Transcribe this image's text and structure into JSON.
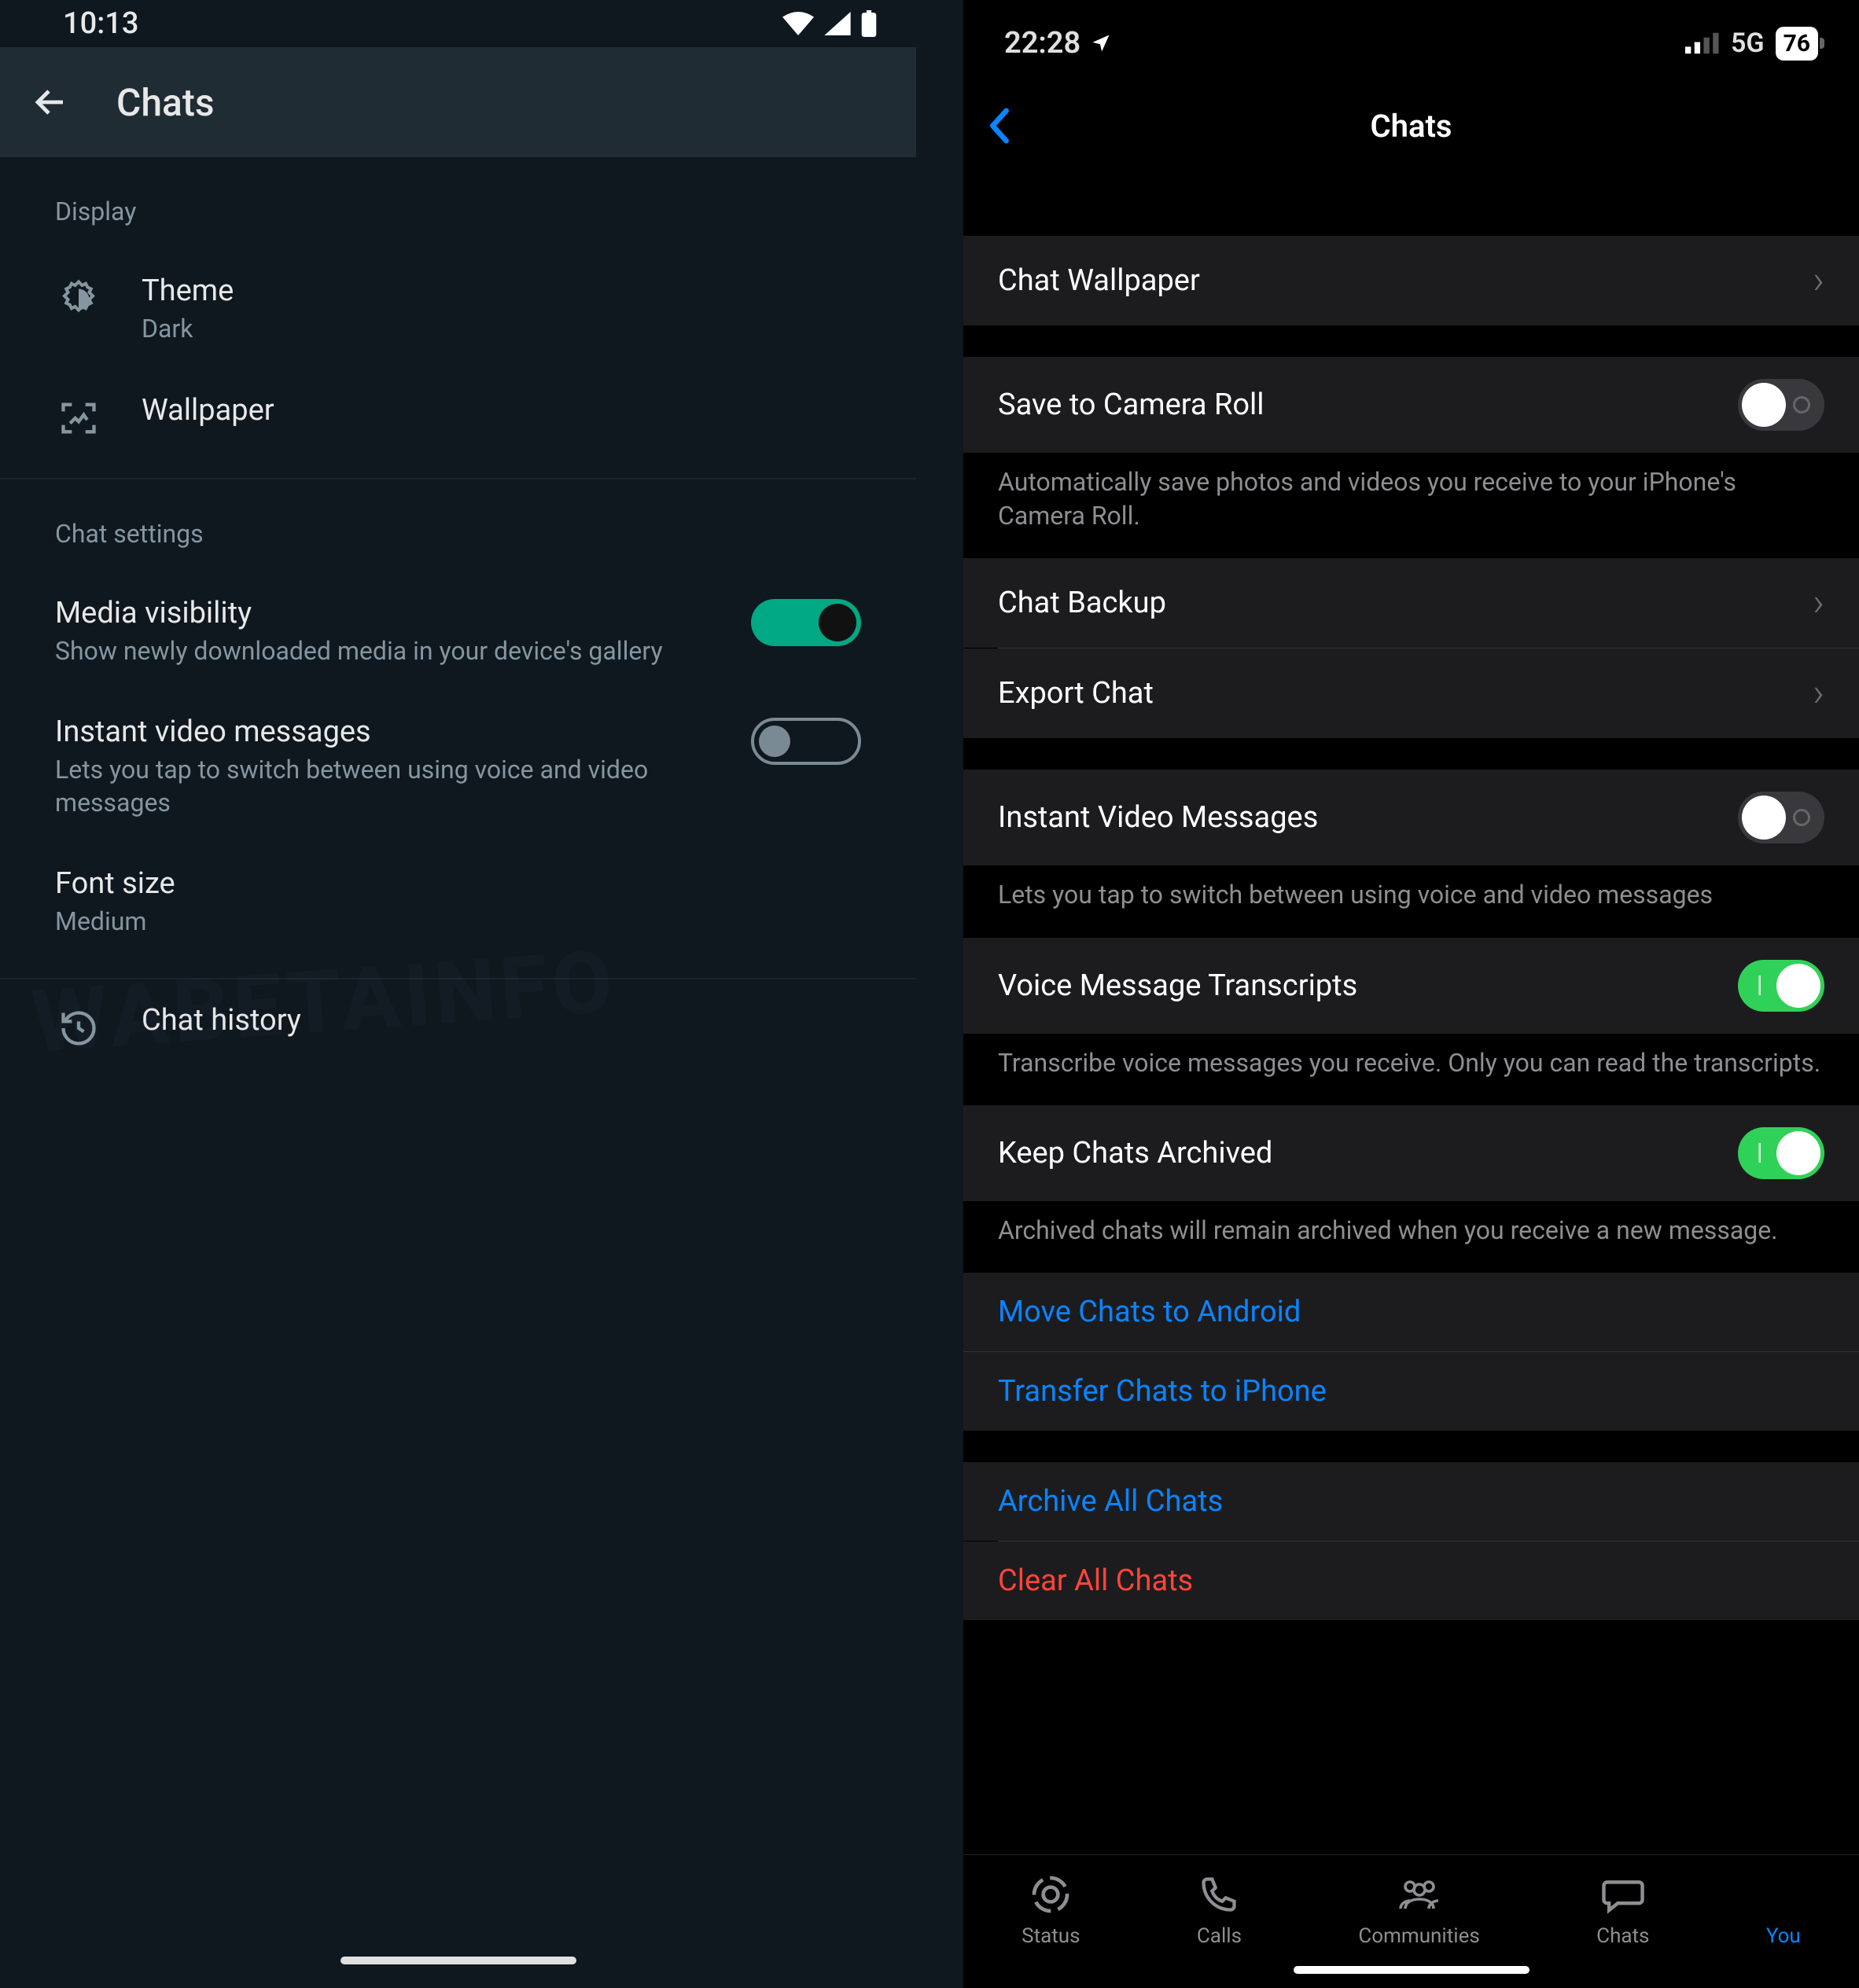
{
  "android": {
    "status": {
      "time": "10:13"
    },
    "appbar": {
      "title": "Chats"
    },
    "sections": {
      "display": {
        "header": "Display",
        "theme": {
          "label": "Theme",
          "value": "Dark"
        },
        "wallpaper": {
          "label": "Wallpaper"
        }
      },
      "chat_settings": {
        "header": "Chat settings",
        "media_visibility": {
          "label": "Media visibility",
          "desc": "Show newly downloaded media in your device's gallery",
          "on": true
        },
        "instant_video": {
          "label": "Instant video messages",
          "desc": "Lets you tap to switch between using voice and video messages",
          "on": false
        },
        "font_size": {
          "label": "Font size",
          "value": "Medium"
        }
      },
      "chat_history": {
        "label": "Chat history"
      }
    },
    "watermark": "WABETAINFO"
  },
  "ios": {
    "status": {
      "time": "22:28",
      "network": "5G",
      "battery": "76"
    },
    "topnav": {
      "title": "Chats"
    },
    "rows": {
      "chat_wallpaper": {
        "label": "Chat Wallpaper"
      },
      "save_camera_roll": {
        "label": "Save to Camera Roll",
        "on": false,
        "caption": "Automatically save photos and videos you receive to your iPhone's Camera Roll."
      },
      "chat_backup": {
        "label": "Chat Backup"
      },
      "export_chat": {
        "label": "Export Chat"
      },
      "instant_video": {
        "label": "Instant Video Messages",
        "on": false,
        "caption": "Lets you tap to switch between using voice and video messages"
      },
      "voice_transcripts": {
        "label": "Voice Message Transcripts",
        "on": true,
        "caption": "Transcribe voice messages you receive. Only you can read the transcripts."
      },
      "keep_archived": {
        "label": "Keep Chats Archived",
        "on": true,
        "caption": "Archived chats will remain archived when you receive a new message."
      },
      "move_android": {
        "label": "Move Chats to Android"
      },
      "transfer_iphone": {
        "label": "Transfer Chats to iPhone"
      },
      "archive_all": {
        "label": "Archive All Chats"
      },
      "clear_all": {
        "label": "Clear All Chats"
      }
    },
    "tabbar": {
      "status": "Status",
      "calls": "Calls",
      "communities": "Communities",
      "chats": "Chats",
      "you": "You"
    }
  }
}
